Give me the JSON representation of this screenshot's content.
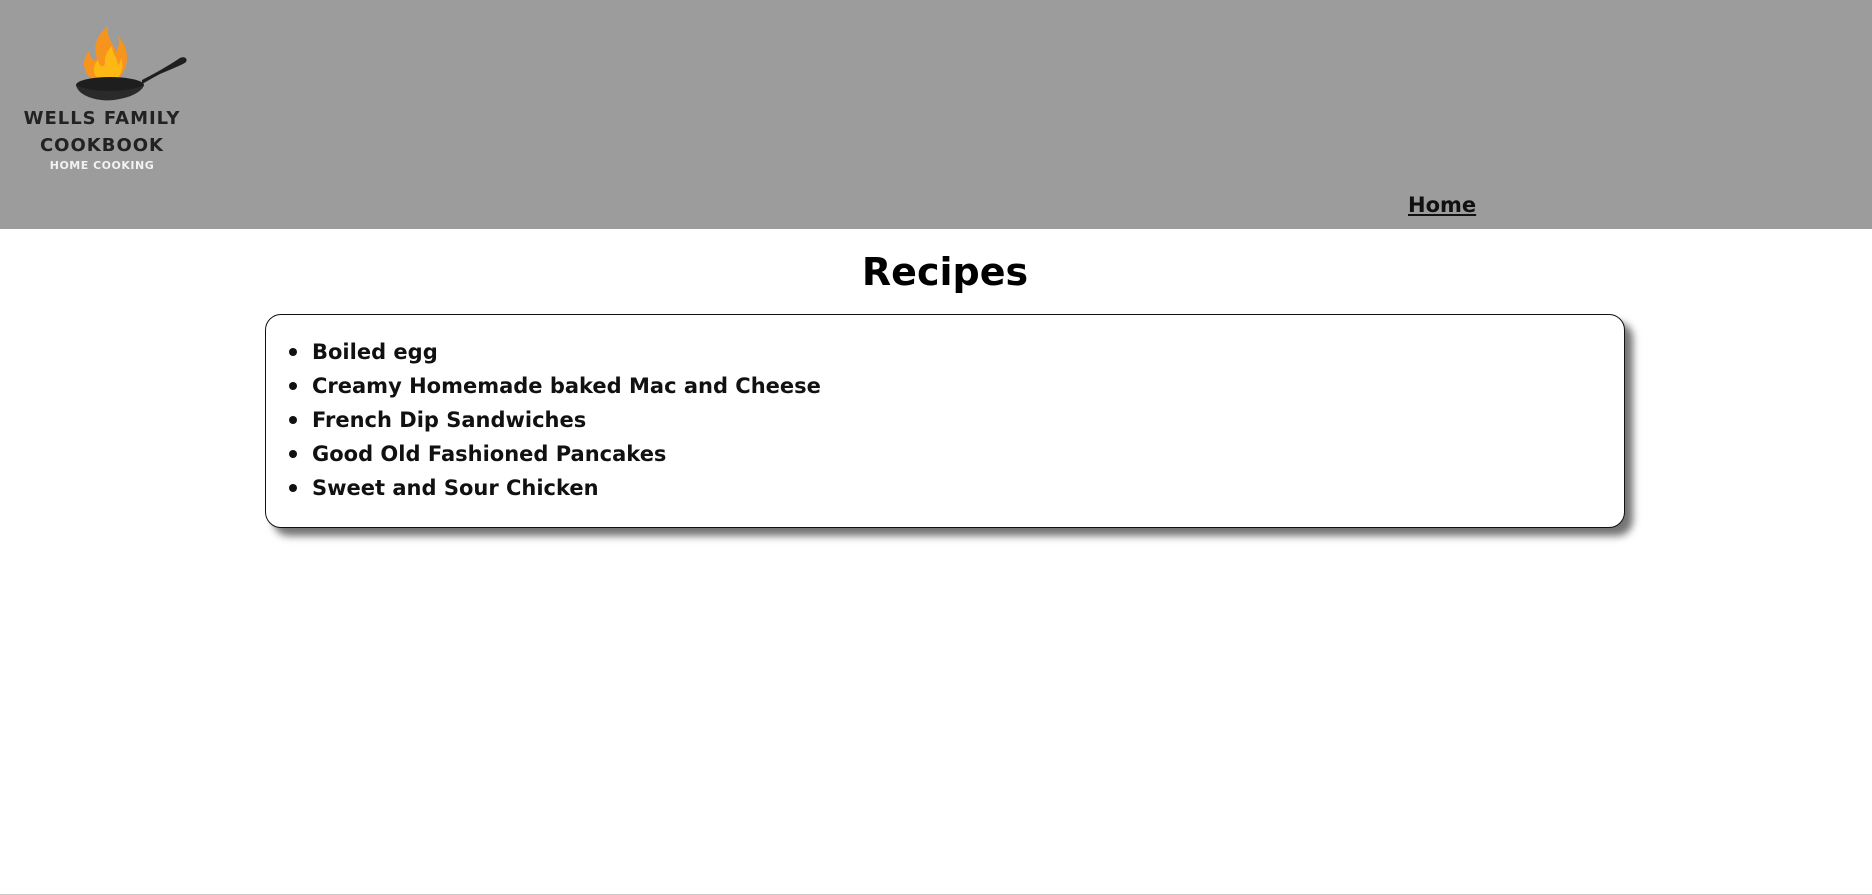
{
  "header": {
    "logo": {
      "title_line1": "WELLS FAMILY",
      "title_line2": "COOKBOOK",
      "tagline": "HOME COOKING",
      "icon": "flaming-pan-icon"
    },
    "nav": {
      "home_label": "Home"
    },
    "background_color": "#9c9c9c"
  },
  "main": {
    "title": "Recipes",
    "recipes": [
      "Boiled egg",
      "Creamy Homemade baked Mac and Cheese",
      "French Dip Sandwiches",
      "Good Old Fashioned Pancakes",
      "Sweet and Sour Chicken"
    ]
  }
}
